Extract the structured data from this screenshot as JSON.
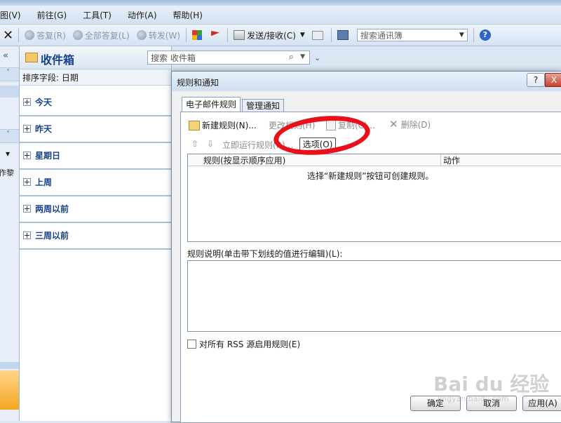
{
  "menubar": {
    "items": [
      "图(V)",
      "前往(G)",
      "工具(T)",
      "动作(A)",
      "帮助(H)"
    ]
  },
  "toolbar": {
    "reply": "答复(R)",
    "reply_all": "全部答复(L)",
    "forward": "转发(W)",
    "send_receive": "发送/接收(C)",
    "address_search_placeholder": "搜索通讯簿"
  },
  "left_strip": {
    "collapse": "«",
    "up1": "˄",
    "up2": "˄",
    "dropdown": "▾",
    "text": "作黎"
  },
  "inbox": {
    "title": "收件箱",
    "search_placeholder": "搜索 收件箱",
    "sort_label": "排序字段: 日期",
    "groups": [
      "今天",
      "昨天",
      "星期日",
      "上周",
      "两周以前",
      "三周以前"
    ]
  },
  "dialog": {
    "title": "规则和通知",
    "help": "?",
    "close": "X",
    "tabs": [
      "电子邮件规则",
      "管理通知"
    ],
    "buttons": {
      "new_rule": "新建规则(N)...",
      "change_rule": "更改规则(H)",
      "copy": "复制(C)...",
      "delete": "删除(D)",
      "run_now": "立即运行规则(R)...",
      "options": "选项(O)"
    },
    "table": {
      "col_rule": "规则(按显示顺序应用)",
      "col_action": "动作",
      "empty_message": "选择“新建规则”按钮可创建规则。"
    },
    "desc_label": "规则说明(单击带下划线的值进行编辑)(L):",
    "rss_label": "对所有 RSS 源启用规则(E)",
    "ok": "确定",
    "cancel": "取消",
    "apply": "应用(A)"
  },
  "watermark": {
    "logo": "Bai du 经验",
    "url": "jingyan.baidu.com"
  }
}
